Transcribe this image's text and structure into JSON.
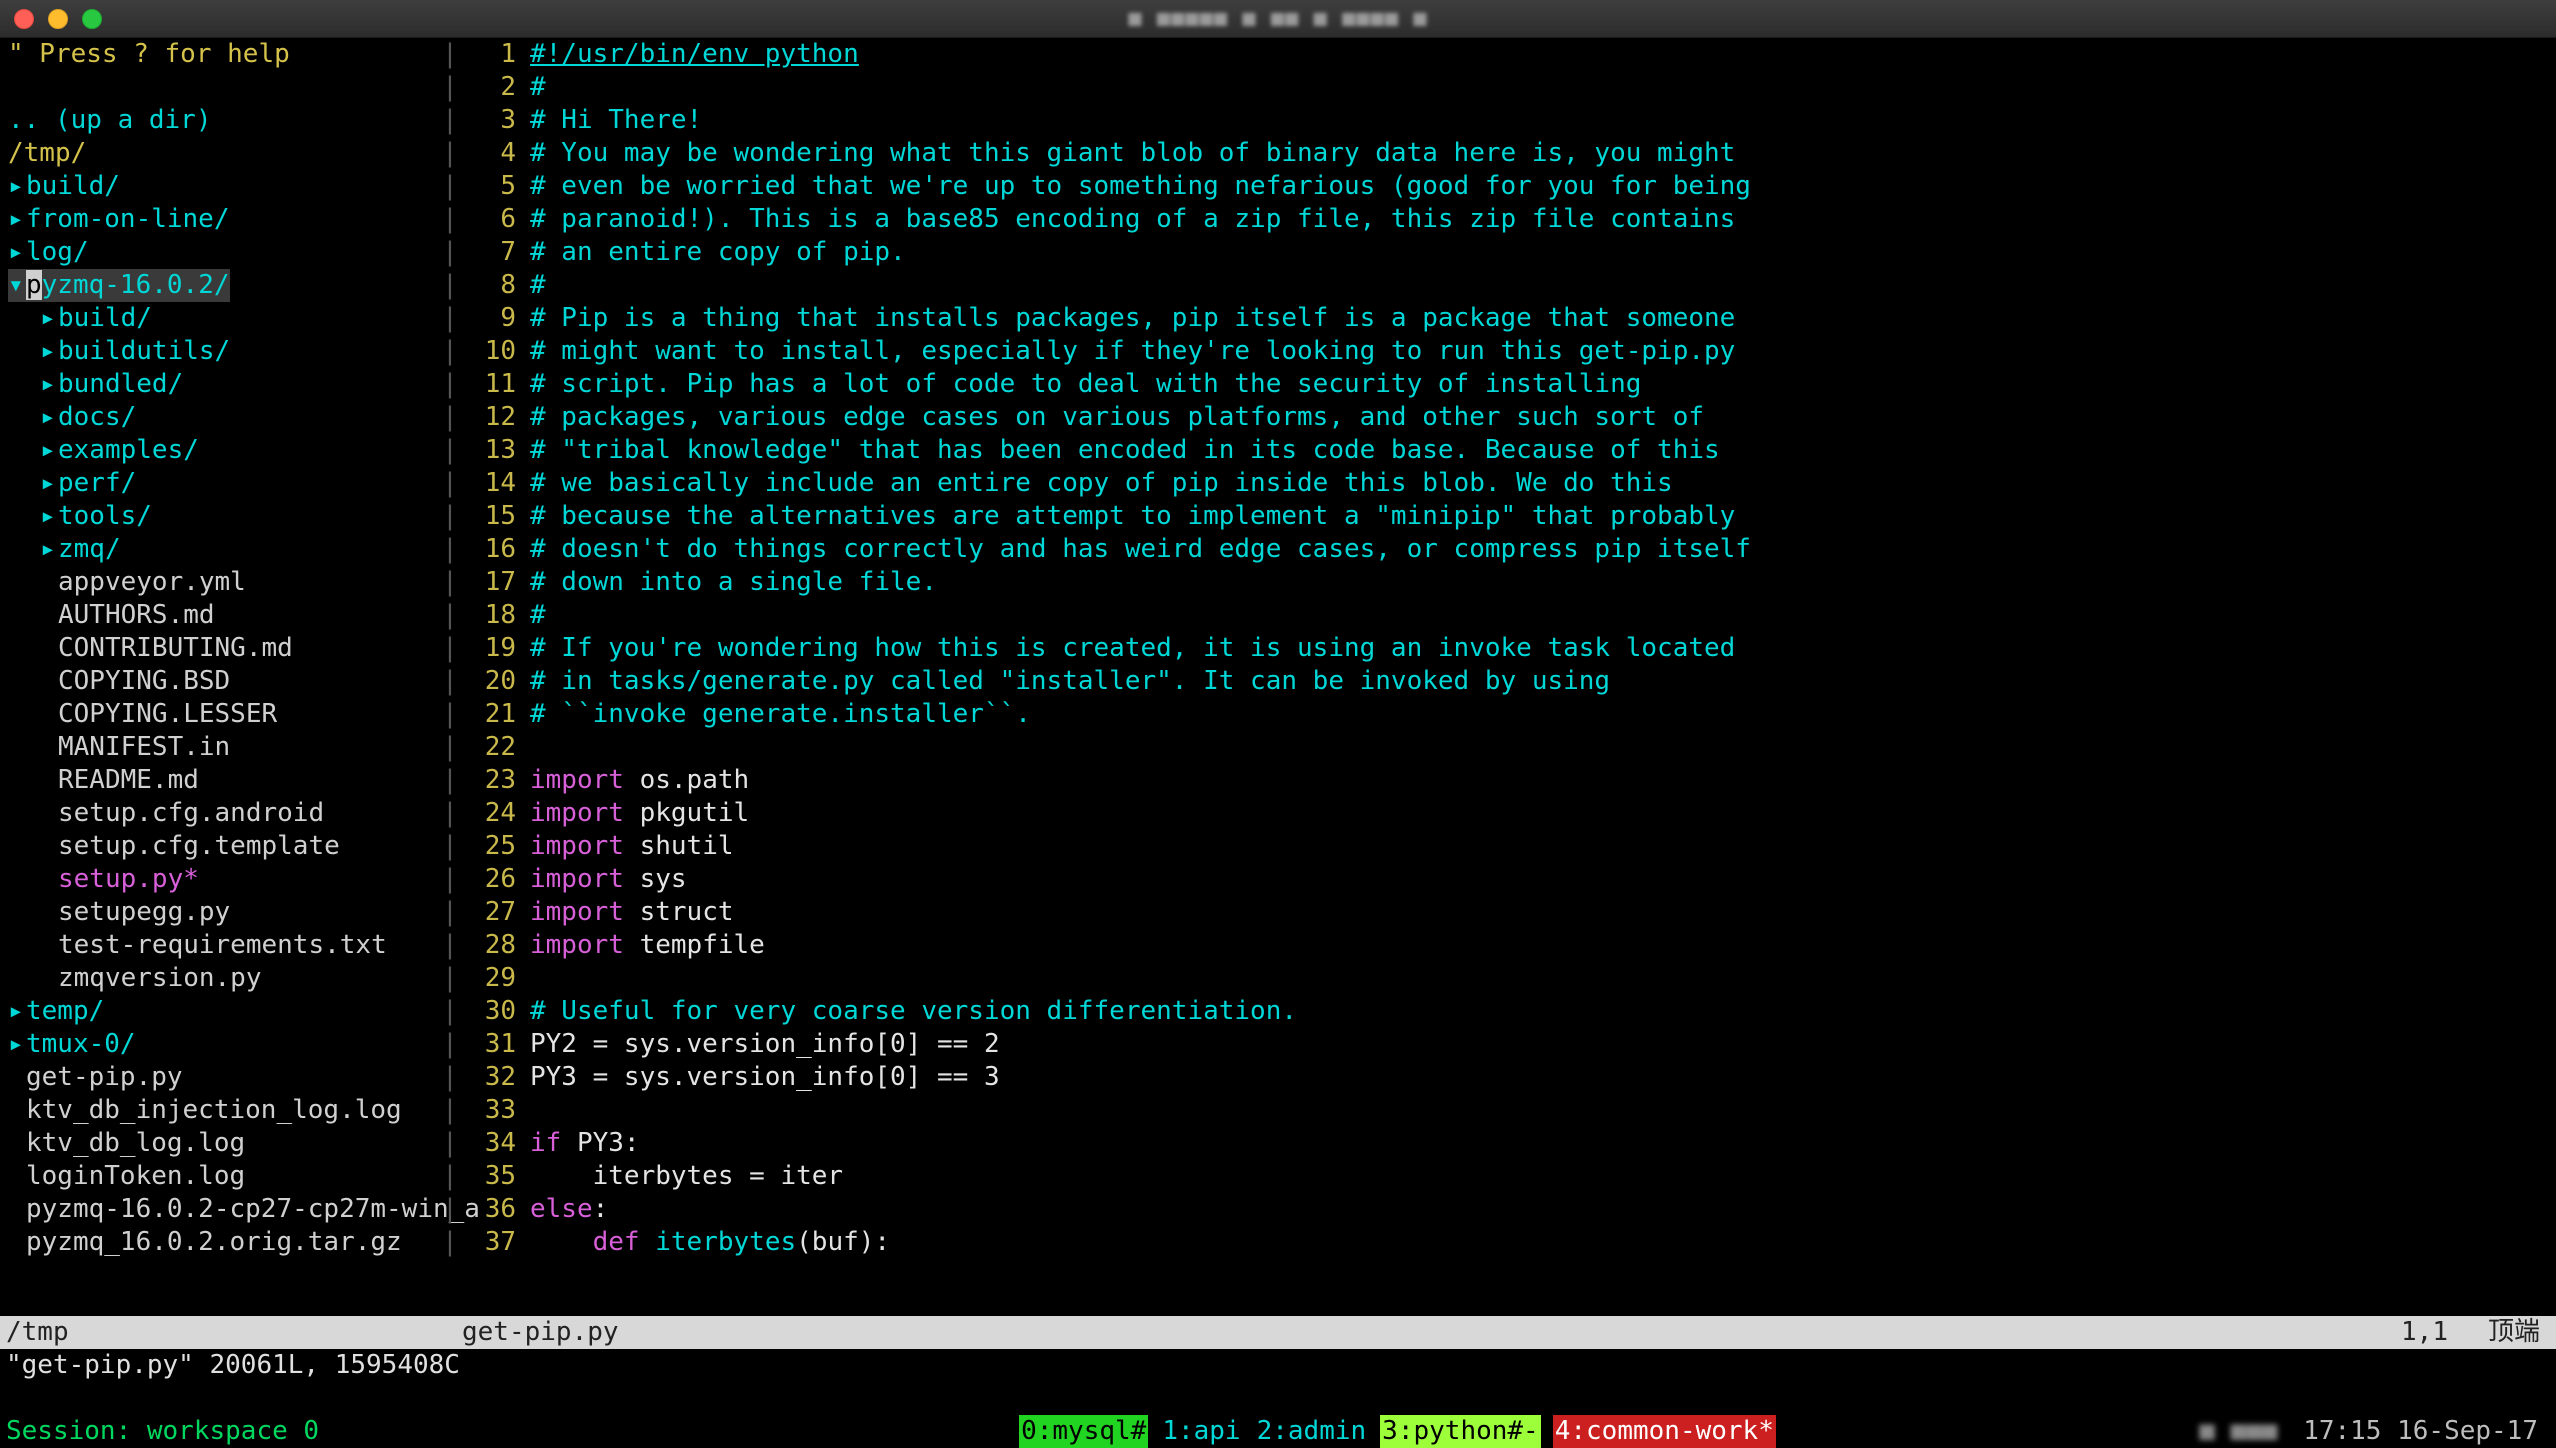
{
  "window": {
    "title": "■ ■■■■■ ■ ■■ ■ ■■■■  ■"
  },
  "nerdtree": {
    "help": "\" Press ? for help",
    "blank": "",
    "updir": ".. (up a dir)",
    "root": "/tmp/",
    "items": [
      {
        "indent": 1,
        "arrow": "▸",
        "name": "build/",
        "cls": "folder"
      },
      {
        "indent": 1,
        "arrow": "▸",
        "name": "from-on-line/",
        "cls": "folder"
      },
      {
        "indent": 1,
        "arrow": "▸",
        "name": "log/",
        "cls": "folder"
      },
      {
        "indent": 1,
        "arrow": "▾",
        "name": "pyzmq-16.0.2/",
        "cls": "folder",
        "selected": true
      },
      {
        "indent": 2,
        "arrow": "▸",
        "name": "build/",
        "cls": "folder"
      },
      {
        "indent": 2,
        "arrow": "▸",
        "name": "buildutils/",
        "cls": "folder"
      },
      {
        "indent": 2,
        "arrow": "▸",
        "name": "bundled/",
        "cls": "folder"
      },
      {
        "indent": 2,
        "arrow": "▸",
        "name": "docs/",
        "cls": "folder"
      },
      {
        "indent": 2,
        "arrow": "▸",
        "name": "examples/",
        "cls": "folder"
      },
      {
        "indent": 2,
        "arrow": "▸",
        "name": "perf/",
        "cls": "folder"
      },
      {
        "indent": 2,
        "arrow": "▸",
        "name": "tools/",
        "cls": "folder"
      },
      {
        "indent": 2,
        "arrow": "▸",
        "name": "zmq/",
        "cls": "folder"
      },
      {
        "indent": 2,
        "arrow": " ",
        "name": "appveyor.yml",
        "cls": "file"
      },
      {
        "indent": 2,
        "arrow": " ",
        "name": "AUTHORS.md",
        "cls": "file"
      },
      {
        "indent": 2,
        "arrow": " ",
        "name": "CONTRIBUTING.md",
        "cls": "file"
      },
      {
        "indent": 2,
        "arrow": " ",
        "name": "COPYING.BSD",
        "cls": "file"
      },
      {
        "indent": 2,
        "arrow": " ",
        "name": "COPYING.LESSER",
        "cls": "file"
      },
      {
        "indent": 2,
        "arrow": " ",
        "name": "MANIFEST.in",
        "cls": "file"
      },
      {
        "indent": 2,
        "arrow": " ",
        "name": "README.md",
        "cls": "file"
      },
      {
        "indent": 2,
        "arrow": " ",
        "name": "setup.cfg.android",
        "cls": "file"
      },
      {
        "indent": 2,
        "arrow": " ",
        "name": "setup.cfg.template",
        "cls": "file"
      },
      {
        "indent": 2,
        "arrow": " ",
        "name": "setup.py*",
        "cls": "exe"
      },
      {
        "indent": 2,
        "arrow": " ",
        "name": "setupegg.py",
        "cls": "file"
      },
      {
        "indent": 2,
        "arrow": " ",
        "name": "test-requirements.txt",
        "cls": "file"
      },
      {
        "indent": 2,
        "arrow": " ",
        "name": "zmqversion.py",
        "cls": "file"
      },
      {
        "indent": 1,
        "arrow": "▸",
        "name": "temp/",
        "cls": "folder"
      },
      {
        "indent": 1,
        "arrow": "▸",
        "name": "tmux-0/",
        "cls": "folder"
      },
      {
        "indent": 1,
        "arrow": " ",
        "name": "get-pip.py",
        "cls": "file"
      },
      {
        "indent": 1,
        "arrow": " ",
        "name": "ktv_db_injection_log.log",
        "cls": "file"
      },
      {
        "indent": 1,
        "arrow": " ",
        "name": "ktv_db_log.log",
        "cls": "file"
      },
      {
        "indent": 1,
        "arrow": " ",
        "name": "loginToken.log",
        "cls": "file"
      },
      {
        "indent": 1,
        "arrow": " ",
        "name": "pyzmq-16.0.2-cp27-cp27m-win_a",
        "cls": "file"
      },
      {
        "indent": 1,
        "arrow": " ",
        "name": "pyzmq_16.0.2.orig.tar.gz",
        "cls": "file"
      }
    ]
  },
  "code": [
    {
      "n": 1,
      "seg": [
        [
          "c-shebang",
          "#!/usr/bin/env python"
        ]
      ],
      "first": true
    },
    {
      "n": 2,
      "seg": [
        [
          "c-comment",
          "#"
        ]
      ]
    },
    {
      "n": 3,
      "seg": [
        [
          "c-comment",
          "# Hi There!"
        ]
      ]
    },
    {
      "n": 4,
      "seg": [
        [
          "c-comment",
          "# You may be wondering what this giant blob of binary data here is, you might"
        ]
      ]
    },
    {
      "n": 5,
      "seg": [
        [
          "c-comment",
          "# even be worried that we're up to something nefarious (good for you for being"
        ]
      ]
    },
    {
      "n": 6,
      "seg": [
        [
          "c-comment",
          "# paranoid!). This is a base85 encoding of a zip file, this zip file contains"
        ]
      ]
    },
    {
      "n": 7,
      "seg": [
        [
          "c-comment",
          "# an entire copy of pip."
        ]
      ]
    },
    {
      "n": 8,
      "seg": [
        [
          "c-comment",
          "#"
        ]
      ]
    },
    {
      "n": 9,
      "seg": [
        [
          "c-comment",
          "# Pip is a thing that installs packages, pip itself is a package that someone"
        ]
      ]
    },
    {
      "n": 10,
      "seg": [
        [
          "c-comment",
          "# might want to install, especially if they're looking to run this get-pip.py"
        ]
      ]
    },
    {
      "n": 11,
      "seg": [
        [
          "c-comment",
          "# script. Pip has a lot of code to deal with the security of installing"
        ]
      ]
    },
    {
      "n": 12,
      "seg": [
        [
          "c-comment",
          "# packages, various edge cases on various platforms, and other such sort of"
        ]
      ]
    },
    {
      "n": 13,
      "seg": [
        [
          "c-comment",
          "# \"tribal knowledge\" that has been encoded in its code base. Because of this"
        ]
      ]
    },
    {
      "n": 14,
      "seg": [
        [
          "c-comment",
          "# we basically include an entire copy of pip inside this blob. We do this"
        ]
      ]
    },
    {
      "n": 15,
      "seg": [
        [
          "c-comment",
          "# because the alternatives are attempt to implement a \"minipip\" that probably"
        ]
      ]
    },
    {
      "n": 16,
      "seg": [
        [
          "c-comment",
          "# doesn't do things correctly and has weird edge cases, or compress pip itself"
        ]
      ]
    },
    {
      "n": 17,
      "seg": [
        [
          "c-comment",
          "# down into a single file."
        ]
      ]
    },
    {
      "n": 18,
      "seg": [
        [
          "c-comment",
          "#"
        ]
      ]
    },
    {
      "n": 19,
      "seg": [
        [
          "c-comment",
          "# If you're wondering how this is created, it is using an invoke task located"
        ]
      ]
    },
    {
      "n": 20,
      "seg": [
        [
          "c-comment",
          "# in tasks/generate.py called \"installer\". It can be invoked by using"
        ]
      ]
    },
    {
      "n": 21,
      "seg": [
        [
          "c-comment",
          "# ``invoke generate.installer``."
        ]
      ]
    },
    {
      "n": 22,
      "seg": []
    },
    {
      "n": 23,
      "seg": [
        [
          "c-key",
          "import"
        ],
        [
          "c-white",
          " os.path"
        ]
      ]
    },
    {
      "n": 24,
      "seg": [
        [
          "c-key",
          "import"
        ],
        [
          "c-white",
          " pkgutil"
        ]
      ]
    },
    {
      "n": 25,
      "seg": [
        [
          "c-key",
          "import"
        ],
        [
          "c-white",
          " shutil"
        ]
      ]
    },
    {
      "n": 26,
      "seg": [
        [
          "c-key",
          "import"
        ],
        [
          "c-white",
          " sys"
        ]
      ]
    },
    {
      "n": 27,
      "seg": [
        [
          "c-key",
          "import"
        ],
        [
          "c-white",
          " struct"
        ]
      ]
    },
    {
      "n": 28,
      "seg": [
        [
          "c-key",
          "import"
        ],
        [
          "c-white",
          " tempfile"
        ]
      ]
    },
    {
      "n": 29,
      "seg": []
    },
    {
      "n": 30,
      "seg": [
        [
          "c-comment",
          "# Useful for very coarse version differentiation."
        ]
      ]
    },
    {
      "n": 31,
      "seg": [
        [
          "c-white",
          "PY2 = sys.version_info[0] == 2"
        ]
      ]
    },
    {
      "n": 32,
      "seg": [
        [
          "c-white",
          "PY3 = sys.version_info[0] == 3"
        ]
      ]
    },
    {
      "n": 33,
      "seg": []
    },
    {
      "n": 34,
      "seg": [
        [
          "c-key",
          "if"
        ],
        [
          "c-white",
          " PY3:"
        ]
      ]
    },
    {
      "n": 35,
      "seg": [
        [
          "c-white",
          "    iterbytes = iter"
        ]
      ]
    },
    {
      "n": 36,
      "seg": [
        [
          "c-key",
          "else"
        ],
        [
          "c-white",
          ":"
        ]
      ]
    },
    {
      "n": 37,
      "seg": [
        [
          "c-white",
          "    "
        ],
        [
          "c-key",
          "def "
        ],
        [
          "c-func",
          "iterbytes"
        ],
        [
          "c-white",
          "(buf):"
        ]
      ]
    }
  ],
  "status": {
    "left": "/tmp",
    "mid": "get-pip.py",
    "pos": "1,1",
    "right": "顶端",
    "msg": "\"get-pip.py\" 20061L, 1595408C"
  },
  "tmux": {
    "session": "Session: workspace 0",
    "windows": [
      {
        "label": "0:mysql#",
        "style": "b-green"
      },
      {
        "label": "1:api",
        "style": "b-cyan"
      },
      {
        "label": "2:admin",
        "style": "b-cyan"
      },
      {
        "label": "3:python#-",
        "style": "b-lime"
      },
      {
        "label": "4:common-work*",
        "style": "b-red"
      }
    ],
    "host": "■ ■■■",
    "clock": "17:15 16-Sep-17"
  }
}
